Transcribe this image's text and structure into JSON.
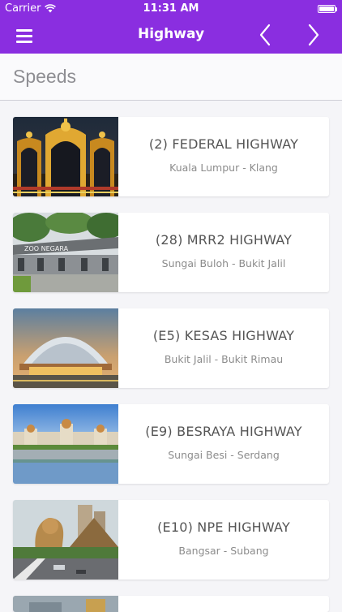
{
  "status_bar": {
    "carrier": "Carrier",
    "time": "11:31 AM",
    "wifi_icon": "wifi-icon",
    "battery_icon": "battery-icon"
  },
  "nav": {
    "title": "Highway",
    "menu_icon": "hamburger-menu-icon",
    "prev_icon": "chevron-left-icon",
    "next_icon": "chevron-right-icon"
  },
  "section": {
    "header": "Speeds"
  },
  "highways": [
    {
      "title": "(2) FEDERAL HIGHWAY",
      "route": "Kuala Lumpur - Klang",
      "photo": "illuminated-arch-gate-night"
    },
    {
      "title": "(28) MRR2 HIGHWAY",
      "route": "Sungai Buloh - Bukit Jalil",
      "photo": "zoo-negara-entrance"
    },
    {
      "title": "(E5) KESAS HIGHWAY",
      "route": "Bukit Jalil - Bukit Rimau",
      "photo": "domed-pavilion-sunset"
    },
    {
      "title": "(E9) BESRAYA HIGHWAY",
      "route": "Sungai Besi - Serdang",
      "photo": "palace-hotel-lake-reflection"
    },
    {
      "title": "(E10) NPE HIGHWAY",
      "route": "Bangsar - Subang",
      "photo": "lion-statue-pyramid-mall"
    }
  ],
  "colors": {
    "nav_bar": "#8a2ee0",
    "background": "#f5f5f8",
    "title_text": "#555555",
    "route_text": "#8c8c8c",
    "section_header_text": "#8e8e93"
  }
}
